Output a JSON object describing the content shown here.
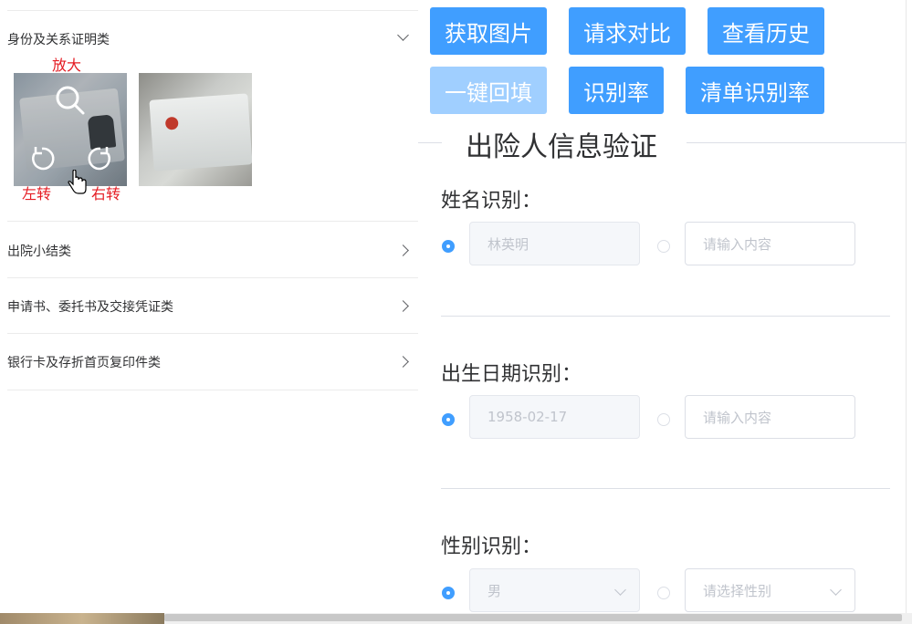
{
  "accordion": {
    "items": [
      {
        "title": "身份及关系证明类",
        "expanded": true
      },
      {
        "title": "出院小结类",
        "expanded": false
      },
      {
        "title": "申请书、委托书及交接凭证类",
        "expanded": false
      },
      {
        "title": "银行卡及存折首页复印件类",
        "expanded": false
      }
    ]
  },
  "image_tools": {
    "zoom_label": "放大",
    "rotate_left_label": "左转",
    "rotate_right_label": "右转"
  },
  "toolbar": {
    "get_image": "获取图片",
    "request_compare": "请求对比",
    "view_history": "查看历史",
    "auto_fill": "一键回填",
    "recognition_rate": "识别率",
    "list_recognition_rate": "清单识别率"
  },
  "form": {
    "section_title": "出险人信息验证",
    "name": {
      "label": "姓名识别：",
      "recognized_value": "林英明",
      "manual_placeholder": "请输入内容"
    },
    "birth_date": {
      "label": "出生日期识别：",
      "recognized_value": "1958-02-17",
      "manual_placeholder": "请输入内容"
    },
    "gender": {
      "label": "性别识别：",
      "recognized_value": "男",
      "manual_placeholder": "请选择性别"
    }
  },
  "colors": {
    "primary": "#409eff",
    "primary_disabled": "#a0cfff",
    "overlay_label": "#e51c23"
  }
}
